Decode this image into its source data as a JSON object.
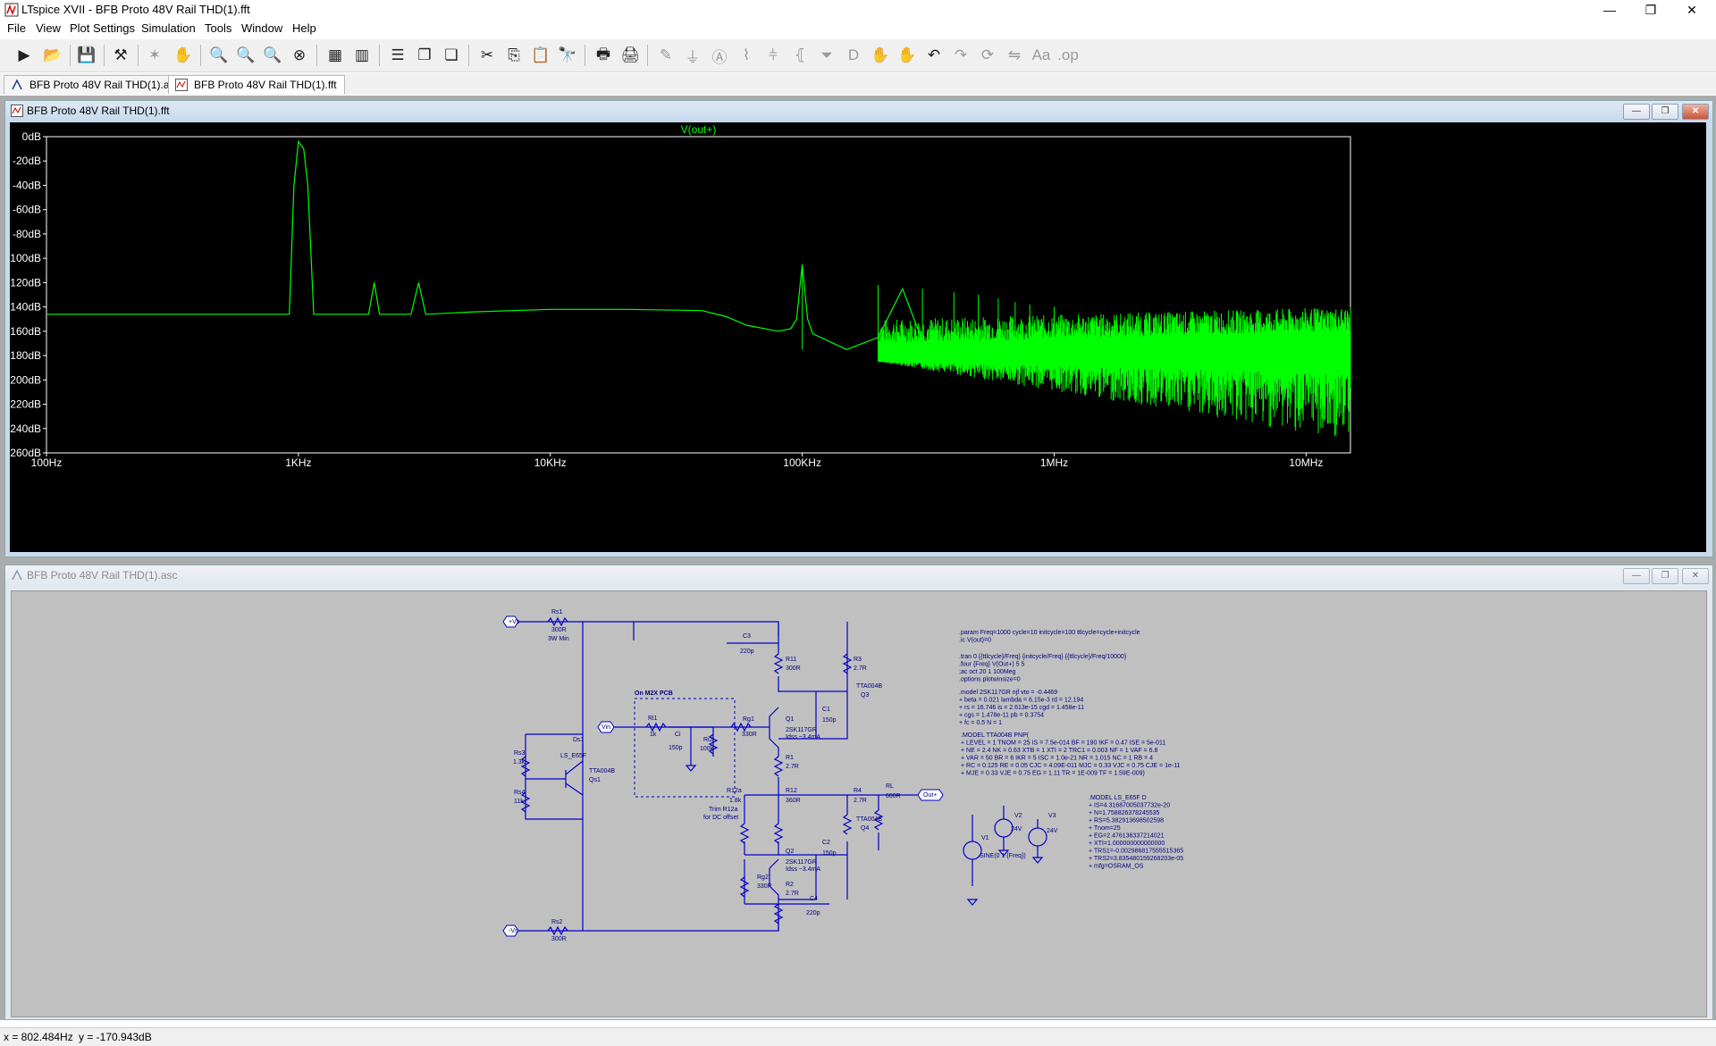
{
  "window": {
    "title": "LTspice XVII - BFB Proto 48V Rail THD(1).fft",
    "minimize": "—",
    "maximize": "❐",
    "close": "✕"
  },
  "menu": [
    "File",
    "View",
    "Plot Settings",
    "Simulation",
    "Tools",
    "Window",
    "Help"
  ],
  "tabs": [
    {
      "label": "BFB Proto 48V Rail THD(1).asc",
      "active": false
    },
    {
      "label": "BFB Proto 48V Rail THD(1).fft",
      "active": true
    }
  ],
  "plot_window": {
    "title": "BFB Proto 48V Rail THD(1).fft"
  },
  "schematic_window": {
    "title": "BFB Proto 48V Rail THD(1).asc"
  },
  "chart_data": {
    "type": "line",
    "title": "V(out+)",
    "xscale": "log",
    "xlim": [
      100,
      15000000
    ],
    "ylim": [
      -260,
      0
    ],
    "yticks": [
      "0dB",
      "-20dB",
      "-40dB",
      "-60dB",
      "-80dB",
      "-100dB",
      "-120dB",
      "-140dB",
      "-160dB",
      "-180dB",
      "-200dB",
      "-220dB",
      "-240dB",
      "-260dB"
    ],
    "xticks": [
      "100Hz",
      "1KHz",
      "10KHz",
      "100KHz",
      "1MHz",
      "10MHz"
    ],
    "series": [
      {
        "name": "V(out+)",
        "color": "#00ff00",
        "x": [
          100,
          850,
          920,
          960,
          1000,
          1050,
          1090,
          1150,
          1900,
          2000,
          2100,
          2200,
          2800,
          3000,
          3200,
          5000,
          10000,
          20000,
          40000,
          50000,
          60000,
          80000,
          90000,
          95000,
          100000,
          105000,
          110000,
          150000,
          200000,
          250000,
          300000,
          400000,
          700000,
          1000000,
          2000000,
          5000000,
          10000000,
          15000000
        ],
        "y": [
          -146,
          -146,
          -146,
          -40,
          -4,
          -10,
          -40,
          -146,
          -146,
          -120,
          -146,
          -146,
          -146,
          -120,
          -146,
          -144,
          -142,
          -142,
          -143,
          -148,
          -155,
          -160,
          -158,
          -150,
          -105,
          -150,
          -162,
          -175,
          -165,
          -125,
          -168,
          -172,
          -175,
          -180,
          -185,
          -190,
          -195,
          -195
        ]
      }
    ],
    "harmonic_spikes": [
      {
        "x": 100000,
        "y": -105
      },
      {
        "x": 200000,
        "y": -122
      },
      {
        "x": 300000,
        "y": -125
      },
      {
        "x": 400000,
        "y": -128
      },
      {
        "x": 500000,
        "y": -130
      },
      {
        "x": 600000,
        "y": -133
      },
      {
        "x": 700000,
        "y": -136
      },
      {
        "x": 800000,
        "y": -138
      },
      {
        "x": 1000000,
        "y": -140
      },
      {
        "x": 2000000,
        "y": -145
      },
      {
        "x": 4000000,
        "y": -150
      },
      {
        "x": 8000000,
        "y": -160
      }
    ],
    "grid": false,
    "background": "#000000",
    "title_color": "#00ff00",
    "axis_color": "#ffffff"
  },
  "schematic": {
    "labels": {
      "rs1": "Rs1",
      "rs1_val": "300R",
      "rs1_note": "3W Min",
      "vs_plus": "+Vs",
      "vs_minus": "-Vs",
      "rs2": "Rs2",
      "rs2_val": "300R",
      "rs3": "Rs3",
      "rs3_val": "1.3k",
      "rs4": "Rs4",
      "rs4_val": "11k",
      "ds1": "Ds1",
      "ds1_val": "LS_E65F",
      "qs1_type": "TTA004B",
      "qs1": "Qs1",
      "c3": "C3",
      "c3_val": "220p",
      "c4": "C4",
      "c4_val": "220p",
      "r11": "R11",
      "r11_val": "300R",
      "r3": "R3",
      "r3_val": "2.7R",
      "q3_type": "TTA004B",
      "q3": "Q3",
      "c1": "C1",
      "c1_val": "150p",
      "pcb": "On M2X PCB",
      "vin": "Vin",
      "ri1": "Ri1",
      "ri1_val": "1k",
      "ci": "Ci",
      "ci_val": "150p",
      "ri2": "Ri2",
      "ri2_val": "100k",
      "rg1": "Rg1",
      "rg1_val": "330R",
      "q1": "Q1",
      "q1_type": "2SK117GR",
      "q1_idss": "Idss ~3.4mA",
      "r1": "R1",
      "r1_val": "2.7R",
      "r12a": "R12a",
      "r12a_val": "1.8k",
      "r12": "R12",
      "r12_val": "360R",
      "trim1": "Trim R12a",
      "trim2": "for DC offset",
      "r4": "R4",
      "r4_val": "2.7R",
      "q4_type": "TTA004B",
      "q4": "Q4",
      "rl": "RL",
      "rl_val": "600R",
      "out_plus": "Out+",
      "c2": "C2",
      "c2_val": "150p",
      "q2": "Q2",
      "q2_type": "2SK117GR",
      "q2_idss": "Idss ~3.4mA",
      "rg2": "Rg2",
      "rg2_val": "330R",
      "r2": "R2",
      "r2_val": "2.7R",
      "v1": "V1",
      "v1_val": "SINE(0 1 {Freq})",
      "v2": "V2",
      "v2_val": "24V",
      "v3": "V3",
      "v3_val": "24V",
      "plus_vs": "+Vs",
      "minus_vs": "-Vs"
    },
    "directives_a": [
      ".param Freq=1000 cycle=10 initcycle=100 ttlcycle=cycle+initcycle",
      ".ic V(out)=0",
      ".tran 0 {{ttlcycle}/Freq} {initcycle/Freq} {{ttlcycle}/Freq/10000}",
      ".four {Freq} V(Out+) 5 5",
      ";ac oct 20 1 100Meg",
      ".options plotwinsize=0"
    ],
    "directives_b": [
      ".model 2SK117GR njf vto = -0.4469",
      "+ beta = 0.021 lambda = 6.15e-3 rd = 12.194",
      "+ rs = 16.746 is = 2.613e-15 cgd = 1.458e-11",
      "+ cgs = 1.478e-11 pb = 0.3754",
      "+ fc = 0.5 N = 1"
    ],
    "directives_c": [
      ".MODEL TTA004B PNP(",
      "+ LEVEL = 1 TNOM = 25 IS = 7.5e-014 BF = 190 IKF = 0.47 ISE = 5e-011",
      "+ NE = 2.4 NK = 0.63 XTB = 1 XTI = 2 TRC1 = 0.003 NF = 1 VAF = 6.8",
      "+ VAR = 50 BR = 6 IKR = 5 ISC = 1.0e-21 NR = 1.015 NC = 1 RB = 4",
      "+ RC = 0.125 RE = 0.05 CJC = 4.09E-011 MJC = 0.33 VJC = 0.75 CJE = 1e-11",
      "+ MJE = 0.33 VJE = 0.75 EG = 1.11 TR = 1E-009 TF = 1.59E-009)"
    ],
    "directives_d": [
      ".MODEL LS_E65F D",
      "+ IS=4.31687005037732e-20",
      "+ N=1.75882637824553​5",
      "+ RS=5.382913698502598",
      "+ Tnom=25",
      "+ EG=2.476136337214021",
      "+ XTI=1.000000000000000",
      "+ TRS1=-0.0029868175555153​65",
      "+ TRS2=3.835480159268203e-05",
      "+ mfg=OSRAM_OS"
    ]
  },
  "status": {
    "x": "x = 802.484Hz",
    "y": "y = -170.943dB"
  }
}
